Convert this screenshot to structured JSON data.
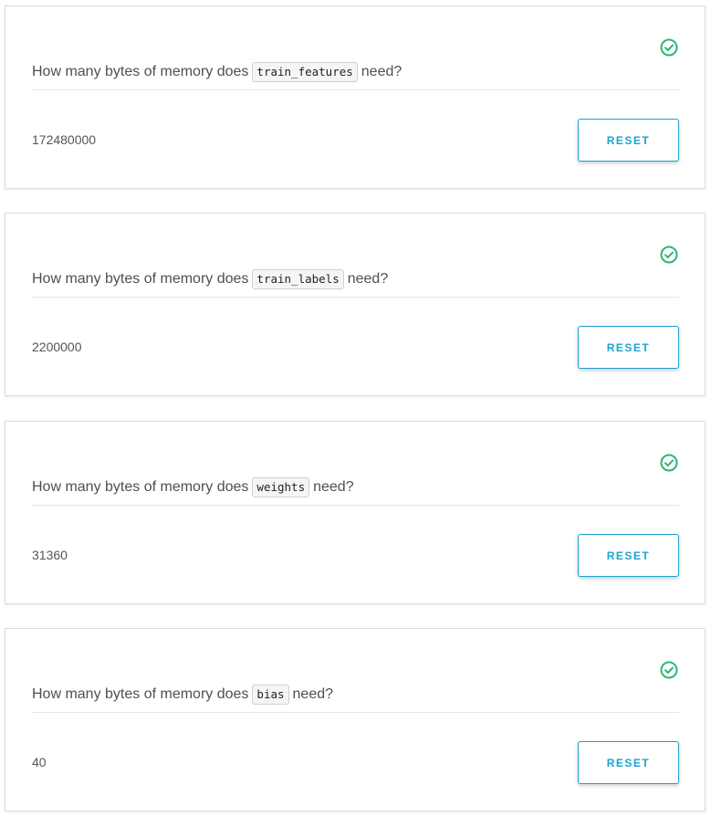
{
  "accent_color": "#1aa3cf",
  "success_color": "#2bb673",
  "questions": [
    {
      "prefix": "How many bytes of memory does",
      "code": "train_features",
      "suffix": "need?",
      "answer": "172480000",
      "reset_label": "RESET",
      "status_icon": "check-circle-icon"
    },
    {
      "prefix": "How many bytes of memory does",
      "code": "train_labels",
      "suffix": "need?",
      "answer": "2200000",
      "reset_label": "RESET",
      "status_icon": "check-circle-icon"
    },
    {
      "prefix": "How many bytes of memory does",
      "code": "weights",
      "suffix": "need?",
      "answer": "31360",
      "reset_label": "RESET",
      "status_icon": "check-circle-icon"
    },
    {
      "prefix": "How many bytes of memory does",
      "code": "bias",
      "suffix": "need?",
      "answer": "40",
      "reset_label": "RESET",
      "status_icon": "check-circle-icon"
    }
  ]
}
